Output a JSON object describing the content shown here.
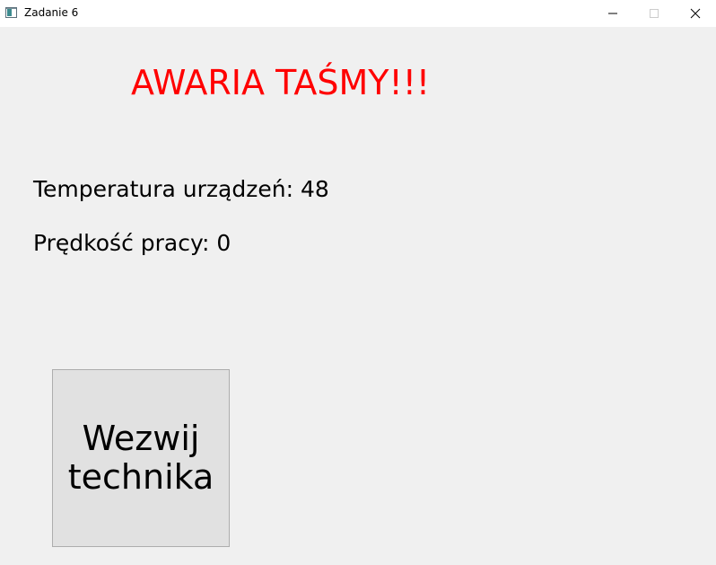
{
  "window": {
    "title": "Zadanie 6",
    "icons": {
      "app": "app-window-icon",
      "minimize": "minimize-icon",
      "maximize": "maximize-icon",
      "close": "close-icon"
    }
  },
  "alert": {
    "text": "AWARIA TAŚMY!!!",
    "color": "#ff0000"
  },
  "info": {
    "temperature_label": "Temperatura urządzeń: 48",
    "speed_label": "Prędkość pracy: 0"
  },
  "actions": {
    "call_technician_label": "Wezwij technika"
  }
}
